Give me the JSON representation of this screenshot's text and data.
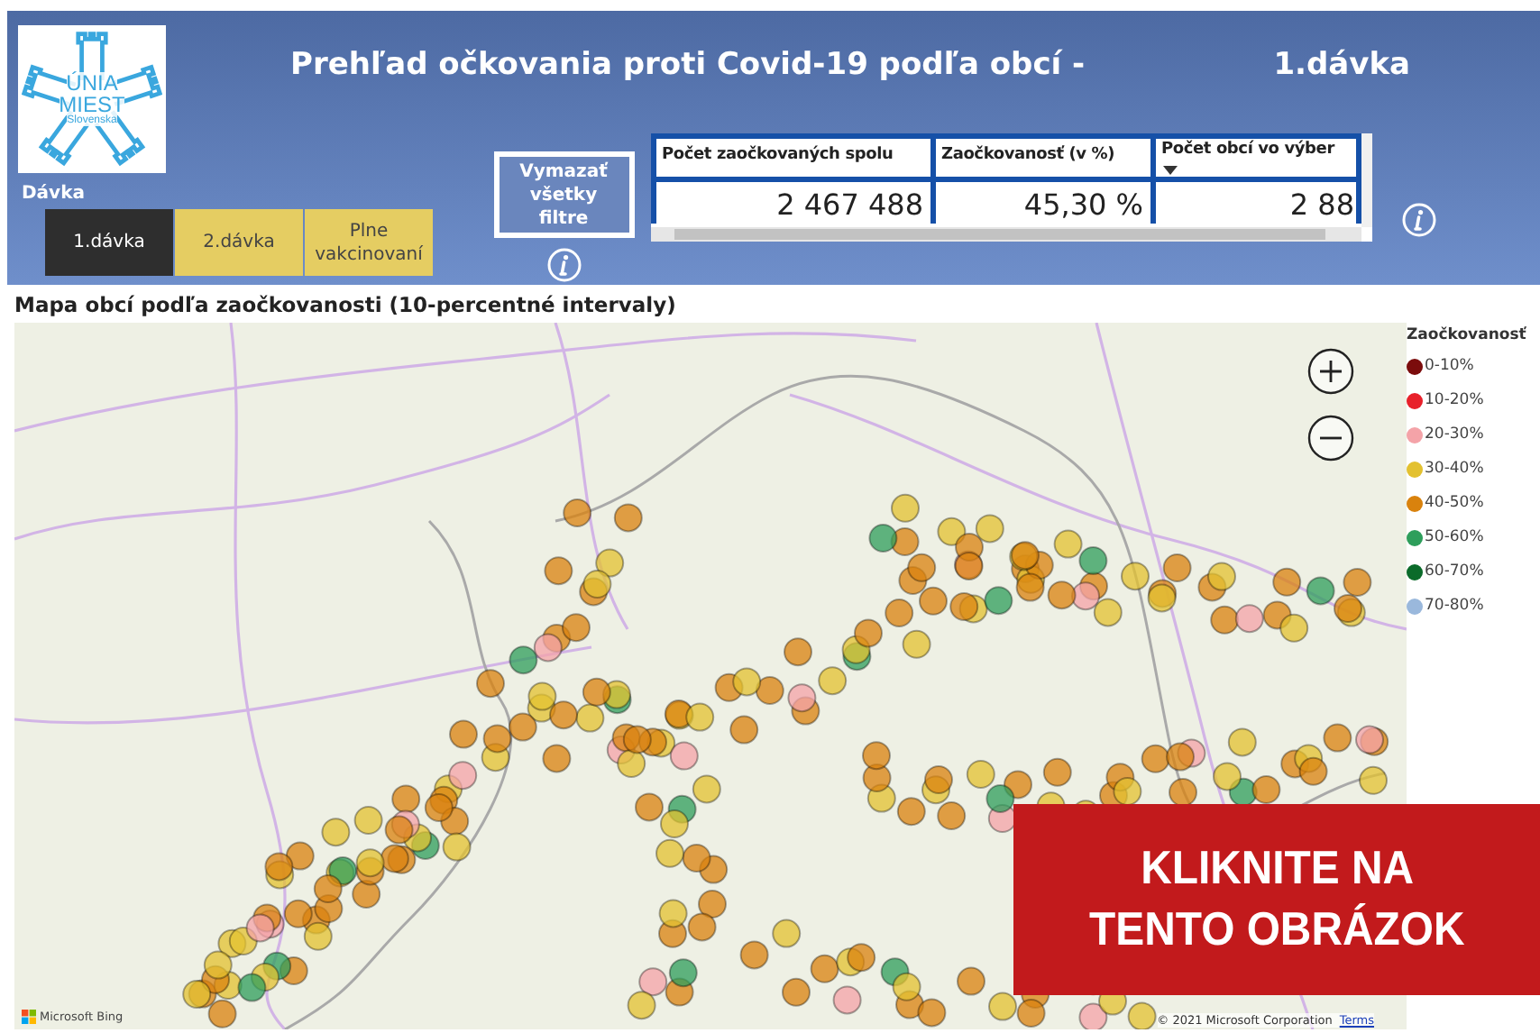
{
  "header": {
    "logo": {
      "lines": [
        "ÚNIA",
        "MIEST",
        "Slovenska"
      ]
    },
    "title": "Prehľad očkovania proti Covid-19 podľa obcí -",
    "dose_title": "1.dávka"
  },
  "dose_filter": {
    "label": "Dávka",
    "options": [
      {
        "label": "1.dávka",
        "selected": true
      },
      {
        "label": "2.dávka",
        "selected": false
      },
      {
        "label": "Plne vakcinovaní",
        "selected": false
      }
    ]
  },
  "clear_button": {
    "label": "Vymazať všetky filtre"
  },
  "table": {
    "columns": [
      {
        "label": "Počet zaočkovaných spolu",
        "sorted": false
      },
      {
        "label": "Zaočkovanosť (v %)",
        "sorted": false
      },
      {
        "label": "Počet obcí vo výber",
        "sorted": true
      }
    ],
    "rows": [
      [
        "2 467 488",
        "45,30 %",
        "2 88"
      ]
    ]
  },
  "map": {
    "title": "Mapa obcí podľa zaočkovanosti (10-percentné intervaly)",
    "legend": {
      "title": "Zaočkovanosť",
      "items": [
        {
          "label": "0-10%",
          "color": "#7b0c0c"
        },
        {
          "label": "10-20%",
          "color": "#e8202a"
        },
        {
          "label": "20-30%",
          "color": "#f4a3a8"
        },
        {
          "label": "30-40%",
          "color": "#e3c130"
        },
        {
          "label": "40-50%",
          "color": "#d9820d"
        },
        {
          "label": "50-60%",
          "color": "#2e9e5b"
        },
        {
          "label": "60-70%",
          "color": "#0b6b2a"
        },
        {
          "label": "70-80%",
          "color": "#9ab8dc"
        }
      ]
    },
    "attribution": "© 2021 Microsoft Corporation",
    "terms_link": "Terms",
    "provider": "Microsoft Bing"
  },
  "banner": {
    "lines": [
      "KLIKNITE NA",
      "TENTO OBRÁZOK"
    ]
  }
}
